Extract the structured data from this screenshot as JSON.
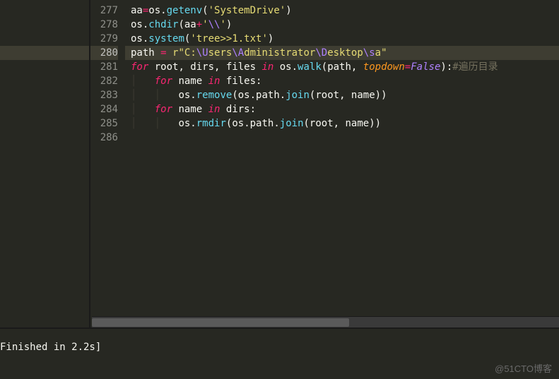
{
  "gutter": {
    "start": 277,
    "count": 10,
    "current": 280
  },
  "code": {
    "lines": [
      {
        "n": 277,
        "tokens": [
          [
            "var",
            "aa"
          ],
          [
            "op",
            "="
          ],
          [
            "var",
            "os"
          ],
          [
            "var",
            "."
          ],
          [
            "fn",
            "getenv"
          ],
          [
            "var",
            "("
          ],
          [
            "str",
            "'SystemDrive'"
          ],
          [
            "var",
            ")"
          ]
        ]
      },
      {
        "n": 278,
        "tokens": [
          [
            "var",
            "os"
          ],
          [
            "var",
            "."
          ],
          [
            "fn",
            "chdir"
          ],
          [
            "var",
            "(aa"
          ],
          [
            "op",
            "+"
          ],
          [
            "str",
            "'"
          ],
          [
            "esc",
            "\\\\"
          ],
          [
            "str",
            "'"
          ],
          [
            "var",
            ")"
          ]
        ]
      },
      {
        "n": 279,
        "tokens": [
          [
            "var",
            "os"
          ],
          [
            "var",
            "."
          ],
          [
            "fn",
            "system"
          ],
          [
            "var",
            "("
          ],
          [
            "str",
            "'tree>>1.txt'"
          ],
          [
            "var",
            ")"
          ]
        ]
      },
      {
        "n": 280,
        "tokens": [
          [
            "var",
            "path "
          ],
          [
            "op",
            "="
          ],
          [
            "var",
            " "
          ],
          [
            "str",
            "r\"C:"
          ],
          [
            "esc",
            "\\U"
          ],
          [
            "str",
            "sers"
          ],
          [
            "esc",
            "\\A"
          ],
          [
            "str",
            "dministrator"
          ],
          [
            "esc",
            "\\D"
          ],
          [
            "str",
            "esktop"
          ],
          [
            "esc",
            "\\s"
          ],
          [
            "str",
            "a\""
          ]
        ]
      },
      {
        "n": 281,
        "tokens": [
          [
            "kw",
            "for"
          ],
          [
            "var",
            " root, dirs, files "
          ],
          [
            "kw",
            "in"
          ],
          [
            "var",
            " os"
          ],
          [
            "var",
            "."
          ],
          [
            "fn",
            "walk"
          ],
          [
            "var",
            "(path, "
          ],
          [
            "param",
            "topdown"
          ],
          [
            "op",
            "="
          ],
          [
            "const",
            "False"
          ],
          [
            "var",
            "):"
          ],
          [
            "comment",
            "#遍历目录"
          ]
        ]
      },
      {
        "n": 282,
        "tokens": [
          [
            "guide",
            "│   "
          ],
          [
            "kw",
            "for"
          ],
          [
            "var",
            " name "
          ],
          [
            "kw",
            "in"
          ],
          [
            "var",
            " files:"
          ]
        ]
      },
      {
        "n": 283,
        "tokens": [
          [
            "guide",
            "│   │   "
          ],
          [
            "var",
            "os"
          ],
          [
            "var",
            "."
          ],
          [
            "fn",
            "remove"
          ],
          [
            "var",
            "(os"
          ],
          [
            "var",
            "."
          ],
          [
            "var",
            "path"
          ],
          [
            "var",
            "."
          ],
          [
            "fn",
            "join"
          ],
          [
            "var",
            "(root, name))"
          ]
        ]
      },
      {
        "n": 284,
        "tokens": [
          [
            "guide",
            "│   "
          ],
          [
            "kw",
            "for"
          ],
          [
            "var",
            " name "
          ],
          [
            "kw",
            "in"
          ],
          [
            "var",
            " dirs:"
          ]
        ]
      },
      {
        "n": 285,
        "tokens": [
          [
            "guide",
            "│   │   "
          ],
          [
            "var",
            "os"
          ],
          [
            "var",
            "."
          ],
          [
            "fn",
            "rmdir"
          ],
          [
            "var",
            "(os"
          ],
          [
            "var",
            "."
          ],
          [
            "var",
            "path"
          ],
          [
            "var",
            "."
          ],
          [
            "fn",
            "join"
          ],
          [
            "var",
            "(root, name))"
          ]
        ]
      },
      {
        "n": 286,
        "tokens": []
      }
    ]
  },
  "console": {
    "output": "Finished in 2.2s]"
  },
  "watermark": "@51CTO博客"
}
